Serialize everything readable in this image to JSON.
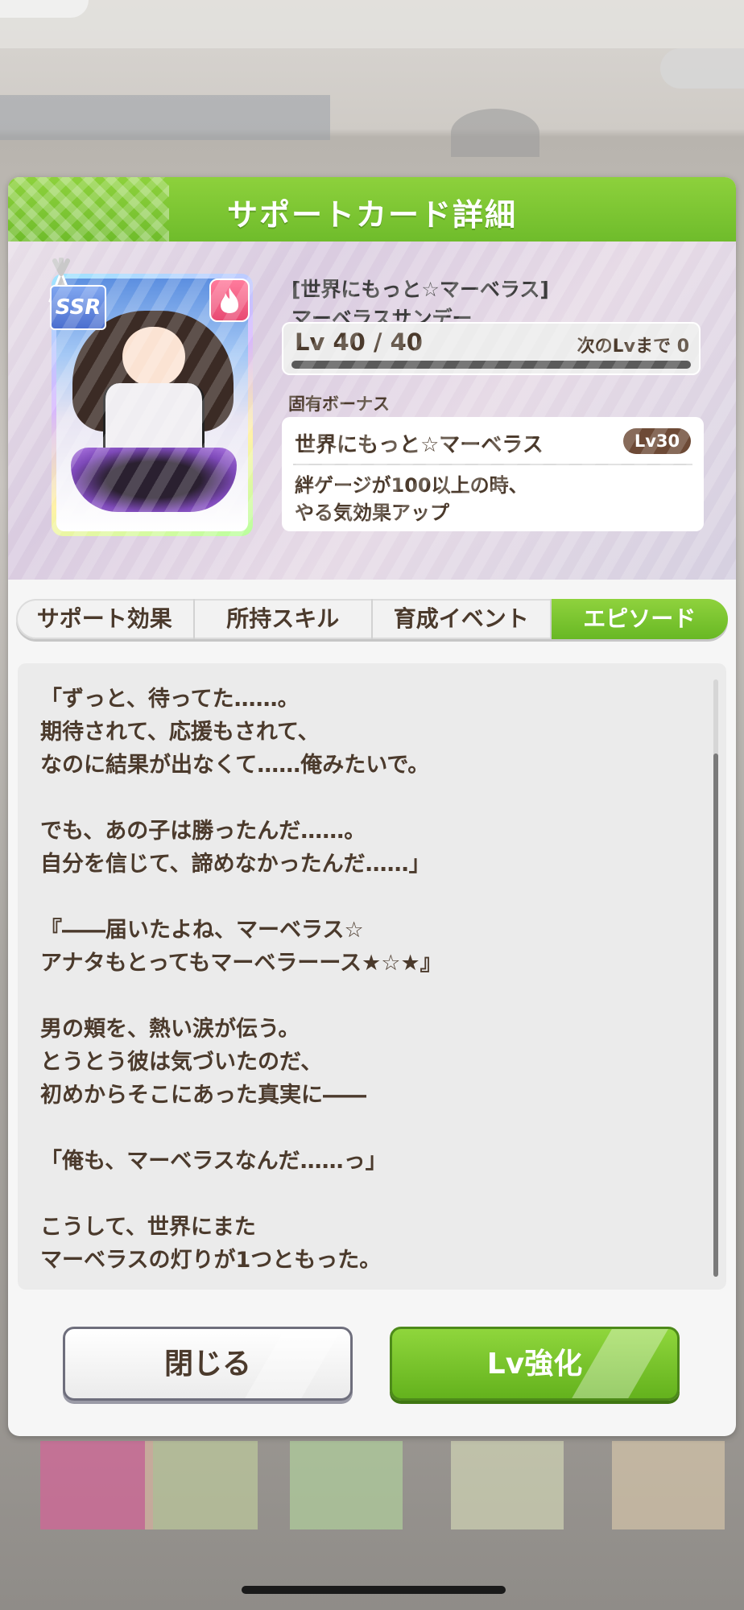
{
  "dialog": {
    "title": "サポートカード詳細"
  },
  "card": {
    "rarity": "SSR",
    "type_icon": "fire-icon",
    "title_line": "[世界にもっと☆マーベラス]",
    "character": "マーベラスサンデー",
    "level": "Lv 40 / 40",
    "next_level": "次のLvまで 0",
    "level_progress_percent": 100
  },
  "bonus": {
    "label": "固有ボーナス",
    "name": "世界にもっと☆マーベラス",
    "level": "Lv30",
    "desc_line1": "絆ゲージが100以上の時、",
    "desc_line2": "やる気効果アップ"
  },
  "tabs": [
    {
      "label": "サポート効果",
      "active": false
    },
    {
      "label": "所持スキル",
      "active": false
    },
    {
      "label": "育成イベント",
      "active": false
    },
    {
      "label": "エピソード",
      "active": true
    }
  ],
  "episode": {
    "lines": [
      "「ずっと、待ってた……。",
      "期待されて、応援もされて、",
      "なのに結果が出なくて……俺みたいで。",
      "",
      "でも、あの子は勝ったんだ……。",
      "自分を信じて、諦めなかったんだ……」",
      "",
      "『――届いたよね、マーベラス☆",
      "アナタもとってもマーベラーース★☆★』",
      "",
      "男の頬を、熱い涙が伝う。",
      "とうとう彼は気づいたのだ、",
      "初めからそこにあった真実に――",
      "",
      "「俺も、マーベラスなんだ……っ」",
      "",
      "こうして、世界にまた",
      "マーベラスの灯りが1つともった。"
    ]
  },
  "buttons": {
    "close": "閉じる",
    "level_up": "Lv強化"
  },
  "colors": {
    "accent_green": "#6fbc2b",
    "text_brown": "#4b3a2c",
    "badge_brown": "#6d4a36"
  }
}
